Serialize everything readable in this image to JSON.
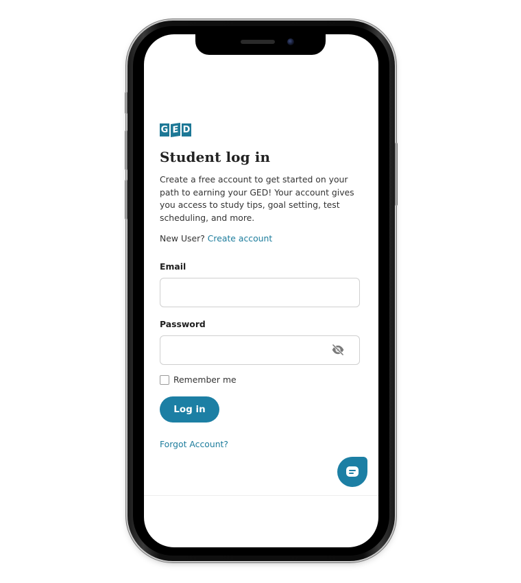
{
  "logo": {
    "letters": [
      "G",
      "E",
      "D"
    ],
    "color": "#1d7896"
  },
  "login": {
    "title": "Student log in",
    "intro": "Create a free account to get started on your path to earning your GED! Your account gives you access to study tips, goal setting, test scheduling, and more.",
    "new_user_prefix": "New User?",
    "create_account_link": "Create account",
    "email_label": "Email",
    "email_value": "",
    "password_label": "Password",
    "password_value": "",
    "remember_label": "Remember me",
    "remember_checked": false,
    "login_button": "Log in",
    "forgot_link": "Forgot Account?"
  },
  "icons": {
    "password_toggle": "eye-off-icon",
    "chat": "chat-bubble-icon"
  },
  "colors": {
    "brand": "#1c7fa4",
    "link": "#1c7c9c",
    "text": "#222222"
  }
}
